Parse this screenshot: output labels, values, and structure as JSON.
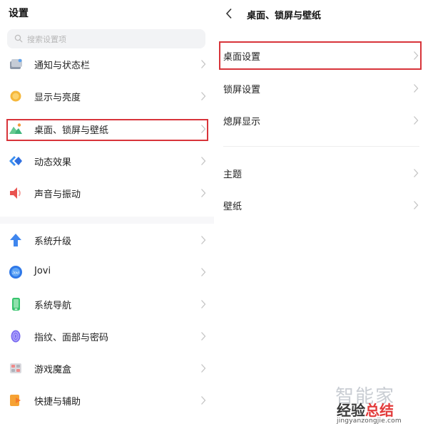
{
  "left": {
    "title": "设置",
    "search": {
      "placeholder": "搜索设置项"
    },
    "items": [
      {
        "label": "通知与状态栏",
        "icon": "notification-icon"
      },
      {
        "label": "显示与亮度",
        "icon": "brightness-icon"
      },
      {
        "label": "桌面、锁屏与壁纸",
        "icon": "wallpaper-icon",
        "highlighted": true
      },
      {
        "label": "动态效果",
        "icon": "motion-effects-icon"
      },
      {
        "label": "声音与振动",
        "icon": "sound-icon"
      },
      {
        "label": "系统升级",
        "icon": "system-update-icon"
      },
      {
        "label": "Jovi",
        "icon": "jovi-icon"
      },
      {
        "label": "系统导航",
        "icon": "navigation-icon"
      },
      {
        "label": "指纹、面部与密码",
        "icon": "fingerprint-icon"
      },
      {
        "label": "游戏魔盒",
        "icon": "game-box-icon"
      },
      {
        "label": "快捷与辅助",
        "icon": "shortcuts-icon"
      }
    ]
  },
  "right": {
    "title": "桌面、锁屏与壁纸",
    "items": [
      {
        "label": "桌面设置",
        "highlighted": true
      },
      {
        "label": "锁屏设置"
      },
      {
        "label": "熄屏显示"
      },
      {
        "label": "主题"
      },
      {
        "label": "壁纸"
      }
    ]
  },
  "watermark": {
    "logo_text": "智能家",
    "main_text_a": "经验",
    "main_text_b": "总结",
    "url": "jingyanzongjie.com"
  },
  "colors": {
    "highlight_border": "#d8343a",
    "chevron": "#c4c4c4",
    "search_bg": "#f2f3f5"
  }
}
